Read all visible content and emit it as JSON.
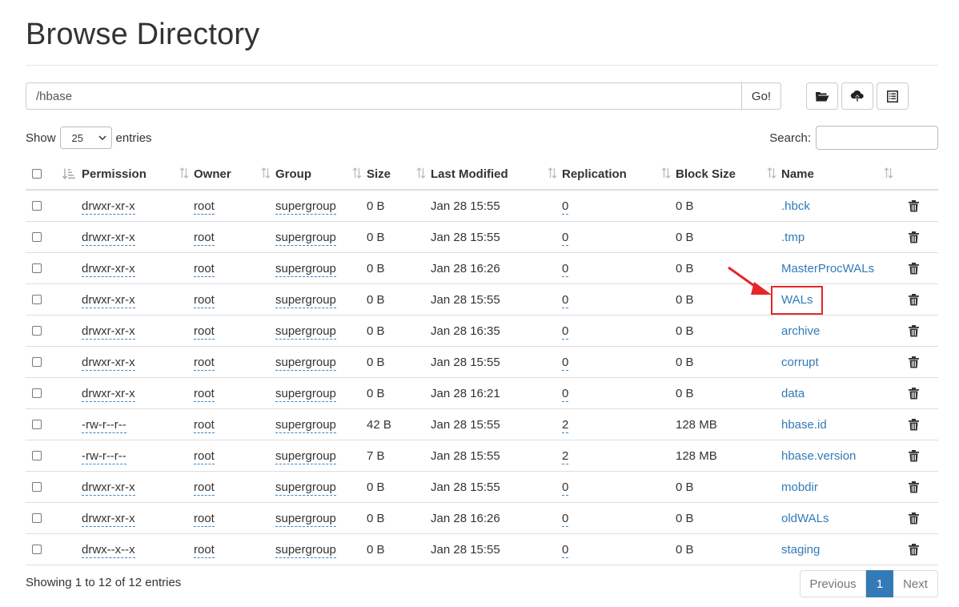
{
  "page": {
    "title": "Browse Directory"
  },
  "path": {
    "value": "/hbase",
    "go_label": "Go!"
  },
  "toolbar": {
    "icons": [
      "folder-open-icon",
      "cloud-upload-icon",
      "list-alt-icon"
    ]
  },
  "length": {
    "show_label": "Show",
    "value": "25",
    "entries_label": "entries"
  },
  "search": {
    "label": "Search:",
    "value": ""
  },
  "table": {
    "columns": [
      "Permission",
      "Owner",
      "Group",
      "Size",
      "Last Modified",
      "Replication",
      "Block Size",
      "Name"
    ],
    "rows": [
      [
        "drwxr-xr-x",
        "root",
        "supergroup",
        "0 B",
        "Jan 28 15:55",
        "0",
        "0 B",
        ".hbck"
      ],
      [
        "drwxr-xr-x",
        "root",
        "supergroup",
        "0 B",
        "Jan 28 15:55",
        "0",
        "0 B",
        ".tmp"
      ],
      [
        "drwxr-xr-x",
        "root",
        "supergroup",
        "0 B",
        "Jan 28 16:26",
        "0",
        "0 B",
        "MasterProcWALs"
      ],
      [
        "drwxr-xr-x",
        "root",
        "supergroup",
        "0 B",
        "Jan 28 15:55",
        "0",
        "0 B",
        "WALs"
      ],
      [
        "drwxr-xr-x",
        "root",
        "supergroup",
        "0 B",
        "Jan 28 16:35",
        "0",
        "0 B",
        "archive"
      ],
      [
        "drwxr-xr-x",
        "root",
        "supergroup",
        "0 B",
        "Jan 28 15:55",
        "0",
        "0 B",
        "corrupt"
      ],
      [
        "drwxr-xr-x",
        "root",
        "supergroup",
        "0 B",
        "Jan 28 16:21",
        "0",
        "0 B",
        "data"
      ],
      [
        "-rw-r--r--",
        "root",
        "supergroup",
        "42 B",
        "Jan 28 15:55",
        "2",
        "128 MB",
        "hbase.id"
      ],
      [
        "-rw-r--r--",
        "root",
        "supergroup",
        "7 B",
        "Jan 28 15:55",
        "2",
        "128 MB",
        "hbase.version"
      ],
      [
        "drwxr-xr-x",
        "root",
        "supergroup",
        "0 B",
        "Jan 28 15:55",
        "0",
        "0 B",
        "mobdir"
      ],
      [
        "drwxr-xr-x",
        "root",
        "supergroup",
        "0 B",
        "Jan 28 16:26",
        "0",
        "0 B",
        "oldWALs"
      ],
      [
        "drwx--x--x",
        "root",
        "supergroup",
        "0 B",
        "Jan 28 15:55",
        "0",
        "0 B",
        "staging"
      ]
    ]
  },
  "footer": {
    "info": "Showing 1 to 12 of 12 entries",
    "previous": "Previous",
    "page": "1",
    "next": "Next"
  },
  "colors": {
    "link": "#337ab7",
    "active_page": "#337ab7",
    "highlight": "#e5262b"
  }
}
